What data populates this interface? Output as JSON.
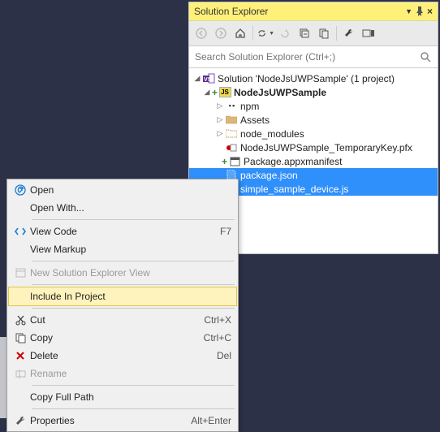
{
  "panel": {
    "title": "Solution Explorer",
    "search_placeholder": "Search Solution Explorer (Ctrl+;)"
  },
  "toolbar": {
    "back": "Back",
    "forward": "Forward",
    "home": "Home",
    "sync": "Sync with Active Document",
    "refresh": "Refresh",
    "collapse": "Collapse All",
    "showall": "Show All Files",
    "properties": "Properties",
    "preview": "Preview Selected Items"
  },
  "tree": {
    "solution": "Solution 'NodeJsUWPSample' (1 project)",
    "project": "NodeJsUWPSample",
    "npm": "npm",
    "assets": "Assets",
    "node_modules": "node_modules",
    "tempkey": "NodeJsUWPSample_TemporaryKey.pfx",
    "manifest": "Package.appxmanifest",
    "package_json": "package.json",
    "simple_sample": "simple_sample_device.js"
  },
  "menu": {
    "open": "Open",
    "open_with": "Open With...",
    "view_code": "View Code",
    "view_code_key": "F7",
    "view_markup": "View Markup",
    "new_explorer": "New Solution Explorer View",
    "include": "Include In Project",
    "cut": "Cut",
    "cut_key": "Ctrl+X",
    "copy": "Copy",
    "copy_key": "Ctrl+C",
    "delete": "Delete",
    "delete_key": "Del",
    "rename": "Rename",
    "copy_full_path": "Copy Full Path",
    "properties": "Properties",
    "properties_key": "Alt+Enter"
  }
}
